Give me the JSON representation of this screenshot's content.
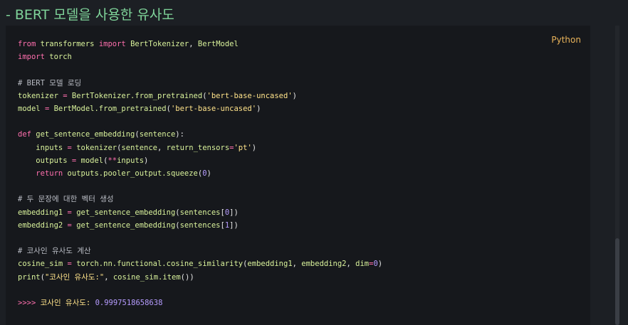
{
  "heading": "- BERT 모델을 사용한 유사도",
  "code": {
    "language": "Python",
    "lines": [
      "from transformers import BertTokenizer, BertModel",
      "import torch",
      "",
      "# BERT 모델 로딩",
      "tokenizer = BertTokenizer.from_pretrained('bert-base-uncased')",
      "model = BertModel.from_pretrained('bert-base-uncased')",
      "",
      "def get_sentence_embedding(sentence):",
      "    inputs = tokenizer(sentence, return_tensors='pt')",
      "    outputs = model(**inputs)",
      "    return outputs.pooler_output.squeeze(0)",
      "",
      "# 두 문장에 대한 벡터 생성",
      "embedding1 = get_sentence_embedding(sentences[0])",
      "embedding2 = get_sentence_embedding(sentences[1])",
      "",
      "# 코사인 유사도 계산",
      "cosine_sim = torch.nn.functional.cosine_similarity(embedding1, embedding2, dim=0)",
      "print(\"코사인 유사도:\", cosine_sim.item())"
    ],
    "output": {
      "prompt": ">>>>",
      "label": "코사인 유사도:",
      "value": "0.9997518658638"
    }
  },
  "colors": {
    "keyword": "#ff6fae",
    "identifier": "#d9f29b",
    "string": "#ffe38a",
    "number": "#b69cff",
    "comment": "#b9bcc4",
    "heading": "#7fd49a",
    "language_badge": "#e9b35a"
  }
}
